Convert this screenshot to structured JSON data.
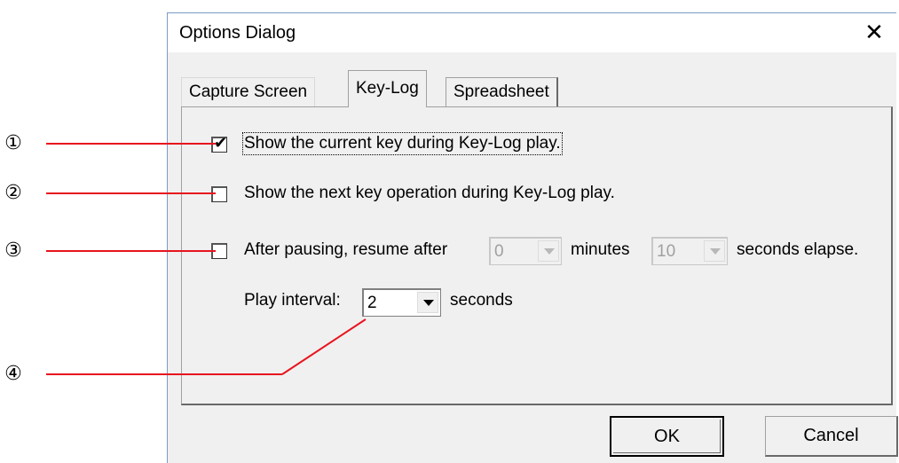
{
  "callouts": [
    "①",
    "②",
    "③",
    "④"
  ],
  "dialog": {
    "title": "Options Dialog",
    "close_glyph": "✕",
    "tabs": [
      "Capture Screen",
      "Key-Log",
      "Spreadsheet"
    ],
    "active_tab": "Key-Log"
  },
  "options": {
    "show_current_key": {
      "label": "Show the current key during Key-Log play.",
      "checked": true
    },
    "show_next_key": {
      "label": "Show the next key operation during Key-Log play.",
      "checked": false
    },
    "resume": {
      "label": "After pausing, resume after",
      "checked": false,
      "minutes_value": "0",
      "minutes_label": "minutes",
      "seconds_value": "10",
      "seconds_label": "seconds elapse."
    },
    "play_interval": {
      "label": "Play interval:",
      "value": "2",
      "unit": "seconds"
    }
  },
  "buttons": {
    "ok": "OK",
    "cancel": "Cancel"
  },
  "colors": {
    "callout_line": "#e8141e",
    "dialog_bg": "#f0f0f0",
    "border_accent": "#7a9cc4"
  }
}
